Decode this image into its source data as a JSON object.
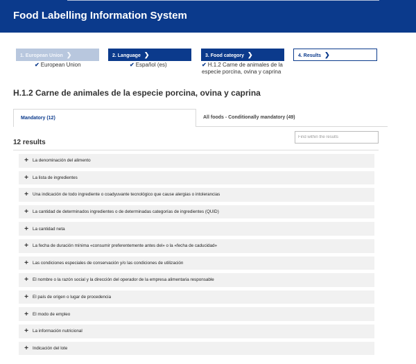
{
  "header": {
    "title": "Food Labelling Information System"
  },
  "steps": [
    {
      "label": "1. European Union",
      "value": "European Union"
    },
    {
      "label": "2. Language",
      "value": "Español (es)"
    },
    {
      "label": "3. Food category",
      "value": "H.1.2 Carne de animales de la especie porcina, ovina y caprina"
    },
    {
      "label": "4. Results",
      "value": ""
    }
  ],
  "category_title": "H.1.2 Carne de animales de la especie porcina, ovina y caprina",
  "tabs": [
    {
      "label": "Mandatory (12)"
    },
    {
      "label": "All foods - Conditionally mandatory (49)"
    }
  ],
  "search": {
    "placeholder": "Find within the results"
  },
  "results_count": "12 results",
  "results": [
    "La denominación del alimento",
    "La lista de ingredientes",
    "Una indicación de todo ingrediente o coadyuvante tecnológico que cause alergias o intolerancias",
    "La cantidad de determinados ingredientes o de determinadas categorías de ingredientes (QUID)",
    "La cantidad neta",
    "La fecha de duración mínima «consumir preferentemente antes del» o la «fecha de caducidad»",
    "Las condiciones especiales de conservación y/o las condiciones de utilización",
    "El nombre o la razón social y la dirección del operador de la empresa alimentaria responsable",
    "El país de origen o lugar de procedencia",
    "El modo de empleo",
    "La información nutricional",
    "Indicación del lote"
  ],
  "colors": {
    "brand": "#0b3a8c",
    "step_done": "#b8c7de",
    "row_bg": "#f1f1f1"
  }
}
